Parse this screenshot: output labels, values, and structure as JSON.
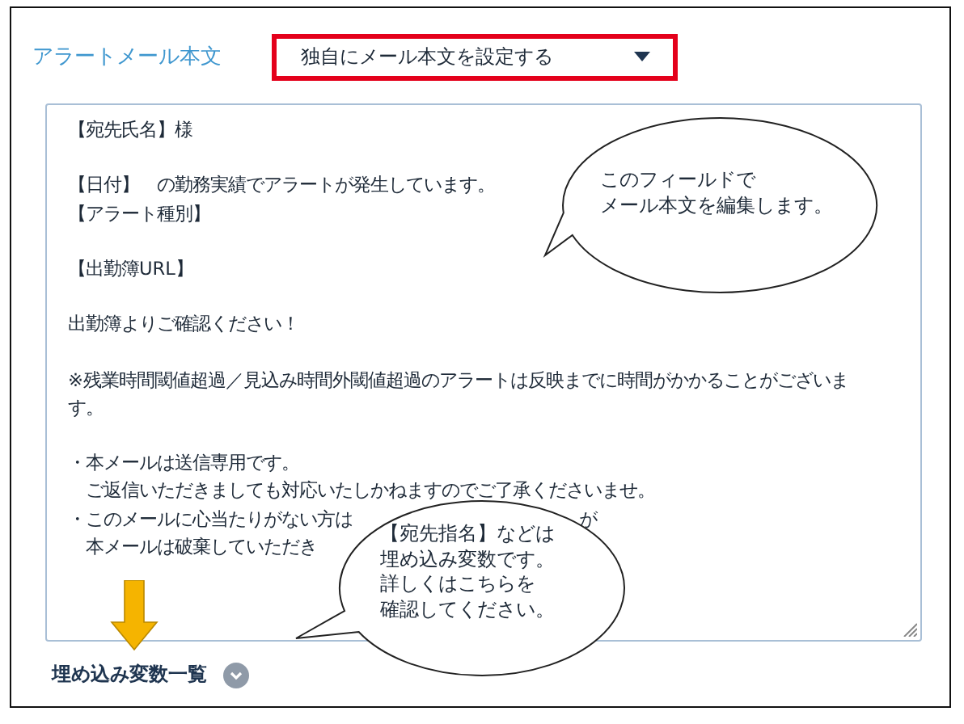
{
  "label": "アラートメール本文",
  "dropdown": {
    "value": "独自にメール本文を設定する"
  },
  "body_paragraphs": [
    {
      "lines": [
        {
          "segments": [
            "【宛先氏名】様"
          ]
        }
      ]
    },
    {
      "lines": [
        {
          "segments": [
            "【日付】　の勤務実績でアラートが発生しています。"
          ]
        },
        {
          "segments": [
            "【アラート種別】"
          ]
        }
      ]
    },
    {
      "lines": [
        {
          "segments": [
            "【出勤簿URL】"
          ]
        }
      ]
    },
    {
      "lines": [
        {
          "segments": [
            "出勤簿よりご確認ください！"
          ]
        }
      ]
    },
    {
      "lines": [
        {
          "segments": [
            "※残業時間閾値超過／見込み時間外閾値超過のアラートは反映までに時間がかかることがございま"
          ]
        },
        {
          "segments": [
            "す。"
          ]
        }
      ]
    },
    {
      "lines": [
        {
          "segments": [
            "・本メールは送信専用です。"
          ]
        },
        {
          "segments": [
            "　ご返信いただきましても対応いたしかねますのでご了承くださいませ。"
          ]
        },
        {
          "segments": [
            "・このメールに心当たりがない方は",
            "が"
          ]
        },
        {
          "segments": [
            "　本メールは破棄していただき"
          ]
        }
      ]
    }
  ],
  "callouts": [
    {
      "kind": "top",
      "lines": [
        "このフィールドで",
        "メール本文を編集します。"
      ]
    },
    {
      "kind": "bottom",
      "lines": [
        "【宛先指名】などは",
        "埋め込み変数です。",
        "詳しくはこちらを",
        "確認してください。"
      ]
    }
  ],
  "footer": {
    "label": "埋め込み変数一覧",
    "expanded": false
  }
}
